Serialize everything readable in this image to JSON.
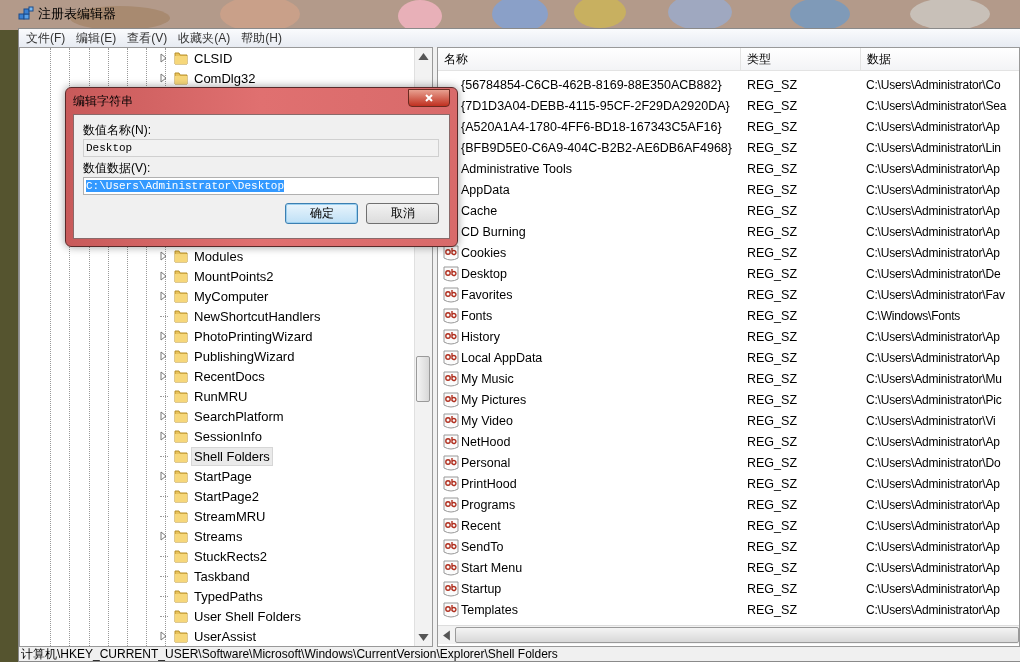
{
  "window": {
    "title": "注册表编辑器"
  },
  "menu": [
    "文件(F)",
    "编辑(E)",
    "查看(V)",
    "收藏夹(A)",
    "帮助(H)"
  ],
  "tree": {
    "top_items": [
      {
        "label": "CLSID",
        "expandable": true,
        "selected": false
      },
      {
        "label": "ComDlg32",
        "expandable": true,
        "selected": false
      }
    ],
    "items": [
      {
        "label": "Modules",
        "expandable": true,
        "selected": false
      },
      {
        "label": "MountPoints2",
        "expandable": true,
        "selected": false
      },
      {
        "label": "MyComputer",
        "expandable": true,
        "selected": false
      },
      {
        "label": "NewShortcutHandlers",
        "expandable": false,
        "selected": false
      },
      {
        "label": "PhotoPrintingWizard",
        "expandable": true,
        "selected": false
      },
      {
        "label": "PublishingWizard",
        "expandable": true,
        "selected": false
      },
      {
        "label": "RecentDocs",
        "expandable": true,
        "selected": false
      },
      {
        "label": "RunMRU",
        "expandable": false,
        "selected": false
      },
      {
        "label": "SearchPlatform",
        "expandable": true,
        "selected": false
      },
      {
        "label": "SessionInfo",
        "expandable": true,
        "selected": false
      },
      {
        "label": "Shell Folders",
        "expandable": false,
        "selected": true
      },
      {
        "label": "StartPage",
        "expandable": true,
        "selected": false
      },
      {
        "label": "StartPage2",
        "expandable": false,
        "selected": false
      },
      {
        "label": "StreamMRU",
        "expandable": false,
        "selected": false
      },
      {
        "label": "Streams",
        "expandable": true,
        "selected": false
      },
      {
        "label": "StuckRects2",
        "expandable": false,
        "selected": false
      },
      {
        "label": "Taskband",
        "expandable": false,
        "selected": false
      },
      {
        "label": "TypedPaths",
        "expandable": false,
        "selected": false
      },
      {
        "label": "User Shell Folders",
        "expandable": false,
        "selected": false
      },
      {
        "label": "UserAssist",
        "expandable": true,
        "selected": false
      }
    ]
  },
  "list": {
    "columns": [
      "名称",
      "类型",
      "数据"
    ],
    "rows": [
      {
        "name": "{56784854-C6CB-462B-8169-88E350ACB882}",
        "type": "REG_SZ",
        "data": "C:\\Users\\Administrator\\Co",
        "icon": false
      },
      {
        "name": "{7D1D3A04-DEBB-4115-95CF-2F29DA2920DA}",
        "type": "REG_SZ",
        "data": "C:\\Users\\Administrator\\Sea",
        "icon": false
      },
      {
        "name": "{A520A1A4-1780-4FF6-BD18-167343C5AF16}",
        "type": "REG_SZ",
        "data": "C:\\Users\\Administrator\\Ap",
        "icon": false
      },
      {
        "name": "{BFB9D5E0-C6A9-404C-B2B2-AE6DB6AF4968}",
        "type": "REG_SZ",
        "data": "C:\\Users\\Administrator\\Lin",
        "icon": false
      },
      {
        "name": "Administrative Tools",
        "type": "REG_SZ",
        "data": "C:\\Users\\Administrator\\Ap",
        "icon": false
      },
      {
        "name": "AppData",
        "type": "REG_SZ",
        "data": "C:\\Users\\Administrator\\Ap",
        "icon": false
      },
      {
        "name": "Cache",
        "type": "REG_SZ",
        "data": "C:\\Users\\Administrator\\Ap",
        "icon": false
      },
      {
        "name": "CD Burning",
        "type": "REG_SZ",
        "data": "C:\\Users\\Administrator\\Ap",
        "icon": false
      },
      {
        "name": "Cookies",
        "type": "REG_SZ",
        "data": "C:\\Users\\Administrator\\Ap",
        "icon": true
      },
      {
        "name": "Desktop",
        "type": "REG_SZ",
        "data": "C:\\Users\\Administrator\\De",
        "icon": true
      },
      {
        "name": "Favorites",
        "type": "REG_SZ",
        "data": "C:\\Users\\Administrator\\Fav",
        "icon": true
      },
      {
        "name": "Fonts",
        "type": "REG_SZ",
        "data": "C:\\Windows\\Fonts",
        "icon": true
      },
      {
        "name": "History",
        "type": "REG_SZ",
        "data": "C:\\Users\\Administrator\\Ap",
        "icon": true
      },
      {
        "name": "Local AppData",
        "type": "REG_SZ",
        "data": "C:\\Users\\Administrator\\Ap",
        "icon": true
      },
      {
        "name": "My Music",
        "type": "REG_SZ",
        "data": "C:\\Users\\Administrator\\Mu",
        "icon": true
      },
      {
        "name": "My Pictures",
        "type": "REG_SZ",
        "data": "C:\\Users\\Administrator\\Pic",
        "icon": true
      },
      {
        "name": "My Video",
        "type": "REG_SZ",
        "data": "C:\\Users\\Administrator\\Vi",
        "icon": true
      },
      {
        "name": "NetHood",
        "type": "REG_SZ",
        "data": "C:\\Users\\Administrator\\Ap",
        "icon": true
      },
      {
        "name": "Personal",
        "type": "REG_SZ",
        "data": "C:\\Users\\Administrator\\Do",
        "icon": true
      },
      {
        "name": "PrintHood",
        "type": "REG_SZ",
        "data": "C:\\Users\\Administrator\\Ap",
        "icon": true
      },
      {
        "name": "Programs",
        "type": "REG_SZ",
        "data": "C:\\Users\\Administrator\\Ap",
        "icon": true
      },
      {
        "name": "Recent",
        "type": "REG_SZ",
        "data": "C:\\Users\\Administrator\\Ap",
        "icon": true
      },
      {
        "name": "SendTo",
        "type": "REG_SZ",
        "data": "C:\\Users\\Administrator\\Ap",
        "icon": true
      },
      {
        "name": "Start Menu",
        "type": "REG_SZ",
        "data": "C:\\Users\\Administrator\\Ap",
        "icon": true
      },
      {
        "name": "Startup",
        "type": "REG_SZ",
        "data": "C:\\Users\\Administrator\\Ap",
        "icon": true
      },
      {
        "name": "Templates",
        "type": "REG_SZ",
        "data": "C:\\Users\\Administrator\\Ap",
        "icon": true
      }
    ]
  },
  "status_bar": "计算机\\HKEY_CURRENT_USER\\Software\\Microsoft\\Windows\\CurrentVersion\\Explorer\\Shell Folders",
  "dialog": {
    "title": "编辑字符串",
    "name_label": "数值名称(N):",
    "name_value": "Desktop",
    "data_label": "数值数据(V):",
    "data_value": "C:\\Users\\Administrator\\Desktop",
    "data_selected": true,
    "buttons": [
      {
        "label": "确定",
        "default": true
      },
      {
        "label": "取消",
        "default": false
      }
    ]
  }
}
